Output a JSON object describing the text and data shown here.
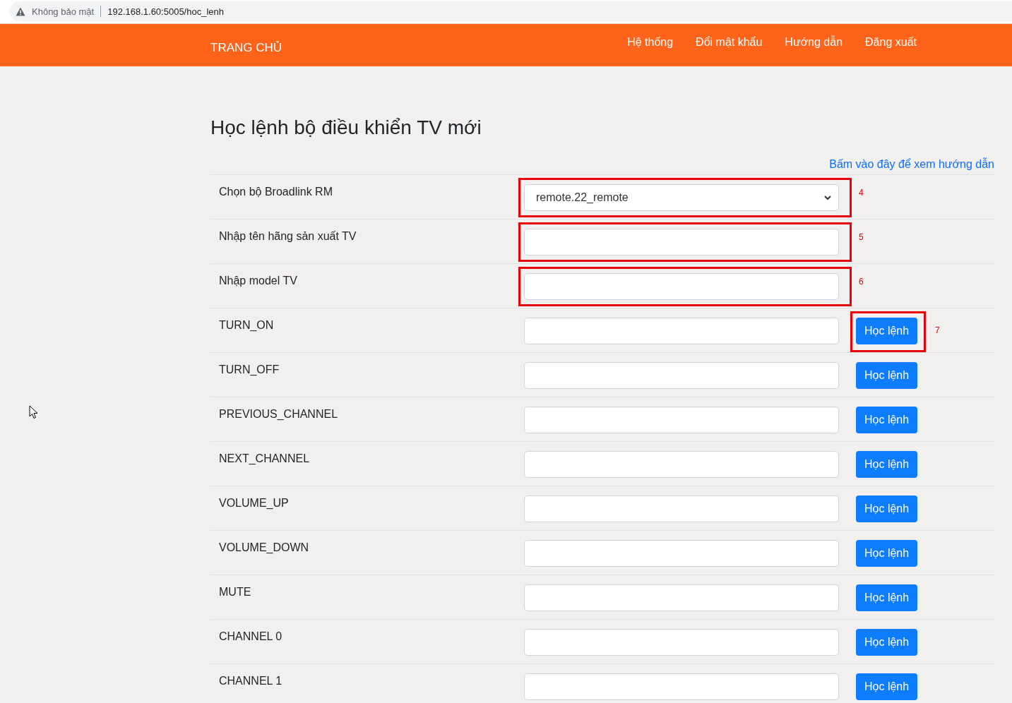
{
  "address_bar": {
    "security": "Không bảo mật",
    "url": "192.168.1.60:5005/hoc_lenh"
  },
  "navbar": {
    "brand": "TRANG CHỦ",
    "links": [
      "Hệ thống",
      "Đổi mật khẩu",
      "Hướng dẫn",
      "Đăng xuất"
    ]
  },
  "page": {
    "title": "Học lệnh bộ điều khiển TV mới",
    "help_link": "Bấm vào đây để xem hướng dẫn"
  },
  "rows": [
    {
      "kind": "select",
      "label": "Chọn bộ Broadlink RM",
      "value": "remote.22_remote",
      "field_annotation": "4"
    },
    {
      "kind": "text",
      "label": "Nhập tên hãng sản xuất TV",
      "field_annotation": "5"
    },
    {
      "kind": "text",
      "label": "Nhập model TV",
      "field_annotation": "6"
    },
    {
      "kind": "learn",
      "label": "TURN_ON",
      "button": "Học lệnh",
      "button_annotation": "7"
    },
    {
      "kind": "learn",
      "label": "TURN_OFF",
      "button": "Học lệnh"
    },
    {
      "kind": "learn",
      "label": "PREVIOUS_CHANNEL",
      "button": "Học lệnh"
    },
    {
      "kind": "learn",
      "label": "NEXT_CHANNEL",
      "button": "Học lệnh"
    },
    {
      "kind": "learn",
      "label": "VOLUME_UP",
      "button": "Học lệnh"
    },
    {
      "kind": "learn",
      "label": "VOLUME_DOWN",
      "button": "Học lệnh"
    },
    {
      "kind": "learn",
      "label": "MUTE",
      "button": "Học lệnh"
    },
    {
      "kind": "learn",
      "label": "CHANNEL 0",
      "button": "Học lệnh"
    },
    {
      "kind": "learn",
      "label": "CHANNEL 1",
      "button": "Học lệnh"
    }
  ]
}
